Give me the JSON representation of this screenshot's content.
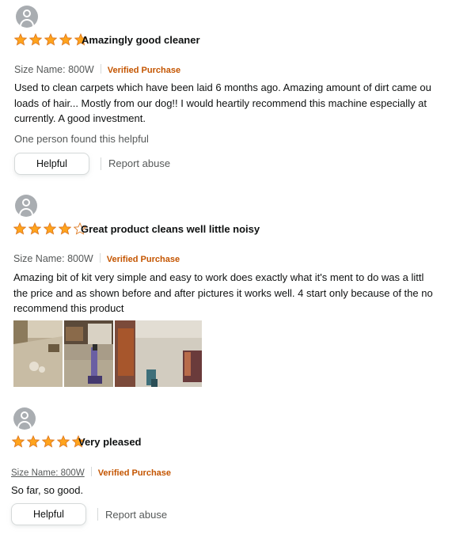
{
  "reviews": [
    {
      "rating": 5,
      "title": "Amazingly good cleaner",
      "size_label": "Size Name: 800W",
      "verified": "Verified Purchase",
      "body_lines": [
        "Used to clean carpets which have been laid 6 months ago. Amazing amount of dirt came ou",
        "loads of hair... Mostly from our dog!! I would heartily recommend this machine especially at",
        "currently. A good investment."
      ],
      "helpful_count_text": "One person found this helpful",
      "helpful_label": "Helpful",
      "report_label": "Report abuse"
    },
    {
      "rating": 4,
      "title": "Great product cleans well little noisy",
      "size_label": "Size Name: 800W",
      "verified": "Verified Purchase",
      "body_lines": [
        "Amazing bit of kit very simple and easy to work does exactly what it's ment to do was a littl",
        "the price and as shown before and after pictures it works well. 4 start only because of the no",
        "recommend this product"
      ],
      "images": [
        "review-photo-carpet-before",
        "review-photo-vacuum",
        "review-photo-carpet-after"
      ]
    },
    {
      "rating": 5,
      "title": "Very pleased",
      "size_label": "Size Name: 800W",
      "verified": "Verified Purchase",
      "body_lines": [
        "So far, so good."
      ],
      "helpful_label": "Helpful",
      "report_label": "Report abuse"
    }
  ],
  "colors": {
    "star": "#ffa41c",
    "star_outline": "#de7921",
    "verified": "#c45500",
    "avatar": "#a9adb1"
  },
  "icons": {
    "avatar": "user-avatar-icon",
    "star_full": "star-filled-icon",
    "star_empty": "star-empty-icon"
  }
}
